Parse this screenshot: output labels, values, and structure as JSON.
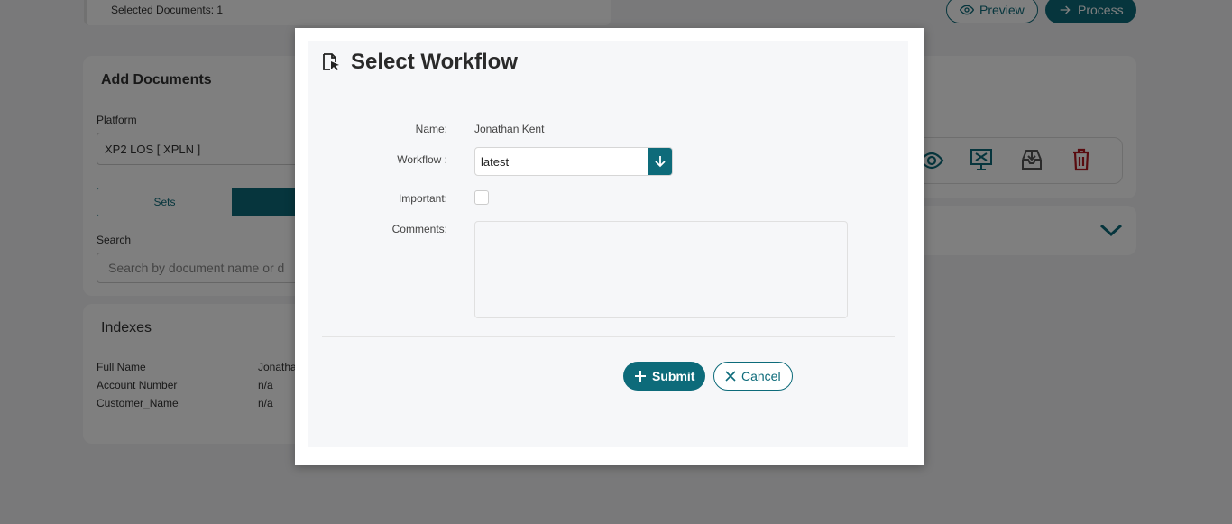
{
  "background": {
    "selected_documents": "Selected Documents: 1",
    "preview_label": "Preview",
    "process_label": "Process",
    "add_documents": {
      "title": "Add Documents",
      "platform_label": "Platform",
      "platform_value": "XP2 LOS [ XPLN ]",
      "tab_sets": "Sets",
      "search_label": "Search",
      "search_placeholder": "Search by document name or d"
    },
    "indexes": {
      "title": "Indexes",
      "rows": [
        {
          "key": "Full Name",
          "value": "Jonatha"
        },
        {
          "key": "Account Number",
          "value": "n/a"
        },
        {
          "key": "Customer_Name",
          "value": "n/a"
        }
      ]
    },
    "icons": [
      "eye-icon",
      "monitor-x-icon",
      "inbox-download-icon",
      "trash-icon",
      "chevron-down-icon"
    ]
  },
  "modal": {
    "title": "Select Workflow",
    "name_label": "Name:",
    "name_value": "Jonathan Kent",
    "workflow_label": "Workflow :",
    "workflow_value": "latest",
    "important_label": "Important:",
    "comments_label": "Comments:",
    "submit_label": "Submit",
    "cancel_label": "Cancel"
  },
  "colors": {
    "accent": "#0d6b7a",
    "danger": "#b3141c"
  }
}
